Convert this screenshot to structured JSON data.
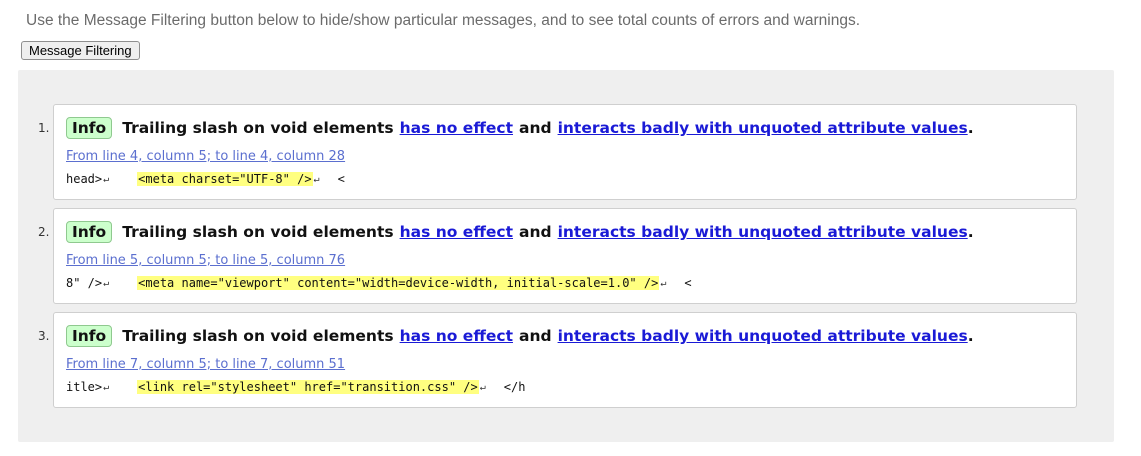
{
  "intro_text": "Use the Message Filtering button below to hide/show particular messages, and to see total counts of errors and warnings.",
  "filter_button_label": "Message Filtering",
  "messages": [
    {
      "number": "1.",
      "badge": "Info",
      "text": "Trailing slash on void elements",
      "link1": "has no effect",
      "and": "and",
      "link2": "interacts badly with unquoted attribute values",
      "period": ".",
      "location": "From line 4, column 5; to line 4, column 28",
      "before": "head>",
      "highlight": "<meta charset=\"UTF-8\" />",
      "after": "<"
    },
    {
      "number": "2.",
      "badge": "Info",
      "text": "Trailing slash on void elements",
      "link1": "has no effect",
      "and": "and",
      "link2": "interacts badly with unquoted attribute values",
      "period": ".",
      "location": "From line 5, column 5; to line 5, column 76",
      "before": "8\" />",
      "highlight": "<meta name=\"viewport\" content=\"width=device-width, initial-scale=1.0\" />",
      "after": "<"
    },
    {
      "number": "3.",
      "badge": "Info",
      "text": "Trailing slash on void elements",
      "link1": "has no effect",
      "and": "and",
      "link2": "interacts badly with unquoted attribute values",
      "period": ".",
      "location": "From line 7, column 5; to line 7, column 51",
      "before": "itle>",
      "highlight": "<link rel=\"stylesheet\" href=\"transition.css\" />",
      "after": "</h"
    }
  ],
  "return_glyph": "↵",
  "colors": {
    "badge_bg": "#ccffcc",
    "highlight_bg": "#ffff80",
    "link": "#1a1ad6",
    "panel_bg": "#efefef"
  }
}
